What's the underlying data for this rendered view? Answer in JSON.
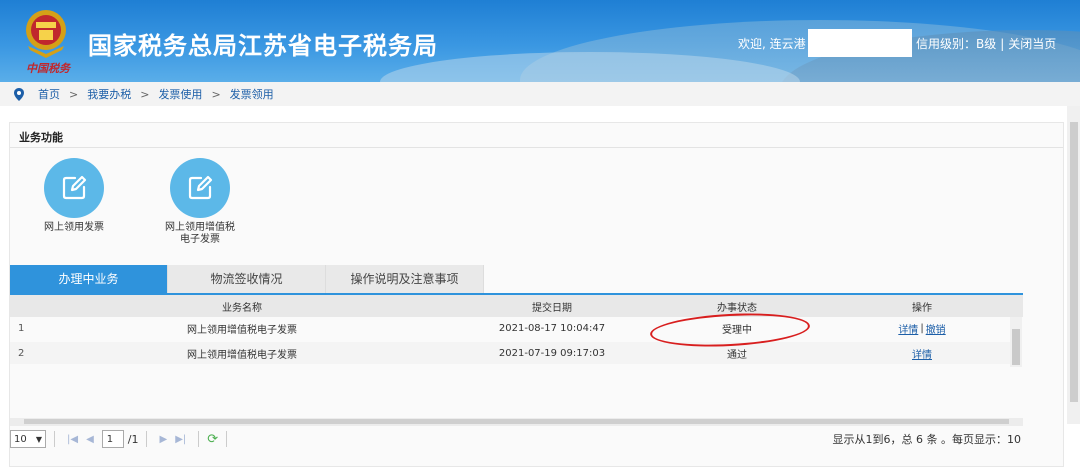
{
  "header": {
    "title": "国家税务总局江苏省电子税务局",
    "logo_subtext": "中国税务",
    "welcome": "欢迎, 连云港",
    "credit": "信用级别：B级",
    "close_page": "关闭当页"
  },
  "breadcrumb": [
    "首页",
    "我要办税",
    "发票使用",
    "发票领用"
  ],
  "section": {
    "title": "业务功能"
  },
  "functions": [
    {
      "label": "网上领用发票"
    },
    {
      "label": "网上领用增值税电子发票"
    }
  ],
  "tabs": [
    "办理中业务",
    "物流签收情况",
    "操作说明及注意事项"
  ],
  "table": {
    "headers": [
      "业务名称",
      "提交日期",
      "办事状态",
      "操作"
    ],
    "rows": [
      {
        "num": "1",
        "name": "网上领用增值税电子发票",
        "date": "2021-08-17 10:04:47",
        "status": "受理中",
        "actions": [
          "详情",
          "撤销"
        ]
      },
      {
        "num": "2",
        "name": "网上领用增值税电子发票",
        "date": "2021-07-19 09:17:03",
        "status": "通过",
        "actions": [
          "详情"
        ]
      }
    ]
  },
  "pager": {
    "page_size": "10",
    "current_page": "1",
    "total_pages": "/1",
    "info": "显示从1到6，总 6 条 。每页显示：10"
  },
  "colors": {
    "header": "#2f8ad9",
    "tab_active": "#2f93dc",
    "link": "#1d5fa8",
    "annotation": "#d81e1e"
  }
}
